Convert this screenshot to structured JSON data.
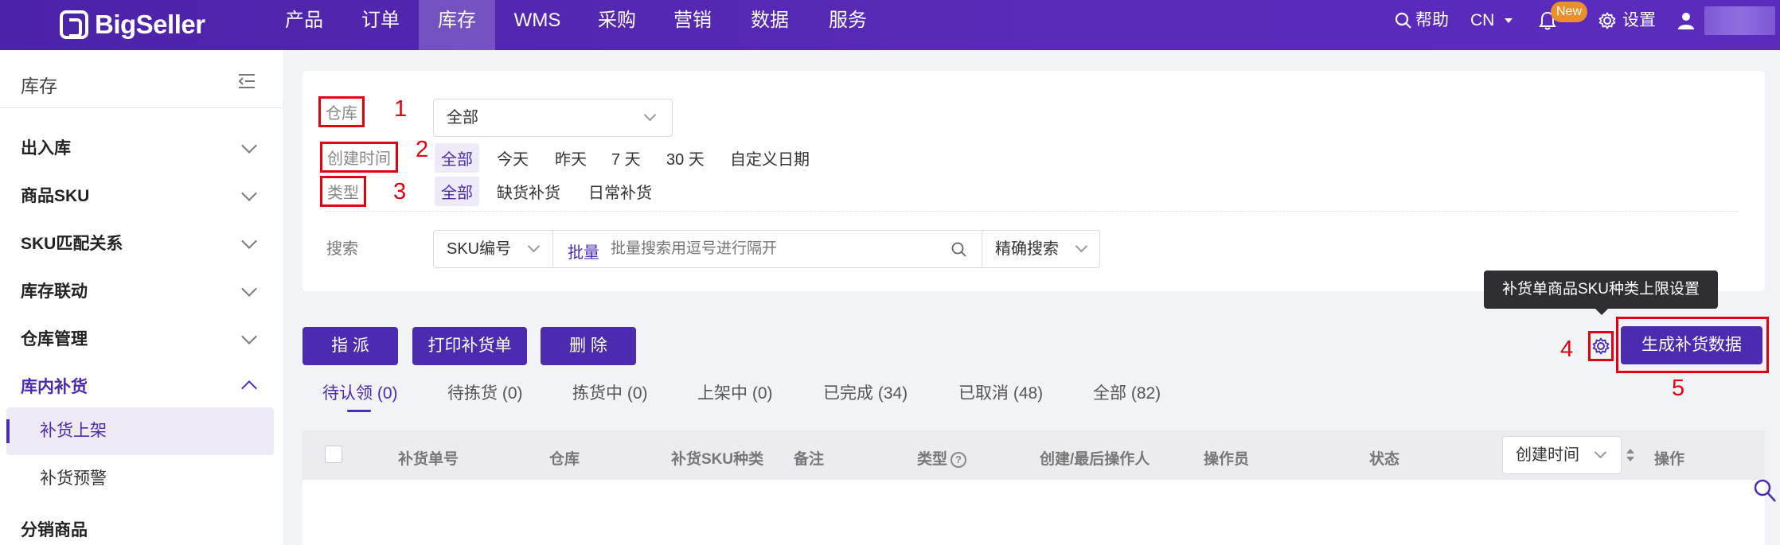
{
  "brand": {
    "name": "BigSeller"
  },
  "nav": {
    "items": [
      {
        "label": "产品"
      },
      {
        "label": "订单"
      },
      {
        "label": "库存"
      },
      {
        "label": "WMS"
      },
      {
        "label": "采购"
      },
      {
        "label": "营销"
      },
      {
        "label": "数据"
      },
      {
        "label": "服务"
      }
    ],
    "active_index": 2,
    "help": "帮助",
    "lang": "CN",
    "new_badge": "New",
    "settings": "设置"
  },
  "sidebar": {
    "title": "库存",
    "items": [
      {
        "label": "出入库"
      },
      {
        "label": "商品SKU"
      },
      {
        "label": "SKU匹配关系"
      },
      {
        "label": "库存联动"
      },
      {
        "label": "仓库管理"
      },
      {
        "label": "库内补货"
      },
      {
        "label": "分销商品"
      }
    ],
    "subitems": [
      {
        "label": "补货上架"
      },
      {
        "label": "补货预警"
      }
    ]
  },
  "filters": {
    "warehouse": {
      "label": "仓库",
      "value": "全部"
    },
    "created": {
      "label": "创建时间",
      "options": [
        "全部",
        "今天",
        "昨天",
        "7 天",
        "30 天",
        "自定义日期"
      ]
    },
    "type": {
      "label": "类型",
      "options": [
        "全部",
        "缺货补货",
        "日常补货"
      ]
    },
    "search": {
      "label": "搜索",
      "field": "SKU编号",
      "batch": "批量",
      "placeholder": "批量搜索用逗号进行隔开",
      "mode": "精确搜索"
    }
  },
  "annotations": [
    "1",
    "2",
    "3",
    "4",
    "5"
  ],
  "actions": {
    "assign": "指 派",
    "print": "打印补货单",
    "delete": "删 除",
    "generate": "生成补货数据",
    "tooltip": "补货单商品SKU种类上限设置"
  },
  "tabs": [
    {
      "label": "待认领 (0)"
    },
    {
      "label": "待拣货 (0)"
    },
    {
      "label": "拣货中 (0)"
    },
    {
      "label": "上架中 (0)"
    },
    {
      "label": "已完成 (34)"
    },
    {
      "label": "已取消 (48)"
    },
    {
      "label": "全部 (82)"
    }
  ],
  "table": {
    "columns": [
      "补货单号",
      "仓库",
      "补货SKU种类",
      "备注",
      "类型",
      "创建/最后操作人",
      "操作员",
      "状态",
      "操作"
    ],
    "sort_select": "创建时间"
  },
  "colors": {
    "brand": "#4b2bb0",
    "annotation": "#e3000f"
  }
}
